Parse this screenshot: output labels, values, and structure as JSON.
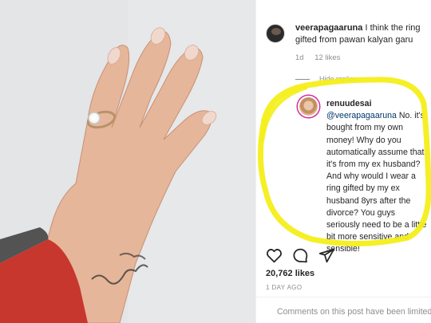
{
  "comment_top": {
    "username": "veerapagaaruna",
    "text": "I think the ring gifted from pawan kalyan garu",
    "age": "1d",
    "likes": "12 likes"
  },
  "hide_replies": "Hide replies",
  "reply": {
    "username": "renuudesai",
    "mention": "@veerapagaaruna",
    "text": "No. it's bought from my own money! Why do you automatically assume that it's from my ex husband? And why would I wear a ring gifted by my ex husband 8yrs after the divorce? You guys seriously need to be a little bit more sensitive and sensible!"
  },
  "post": {
    "likes": "20,762 likes",
    "posted": "1 DAY AGO",
    "comments_limited": "Comments on this post have been limited"
  },
  "icons": {
    "like": "heart-icon",
    "comment": "comment-icon",
    "share": "share-icon"
  },
  "colors": {
    "highlight": "#f4ee1a",
    "mention": "#00376b",
    "muted": "#8e8e8e"
  }
}
